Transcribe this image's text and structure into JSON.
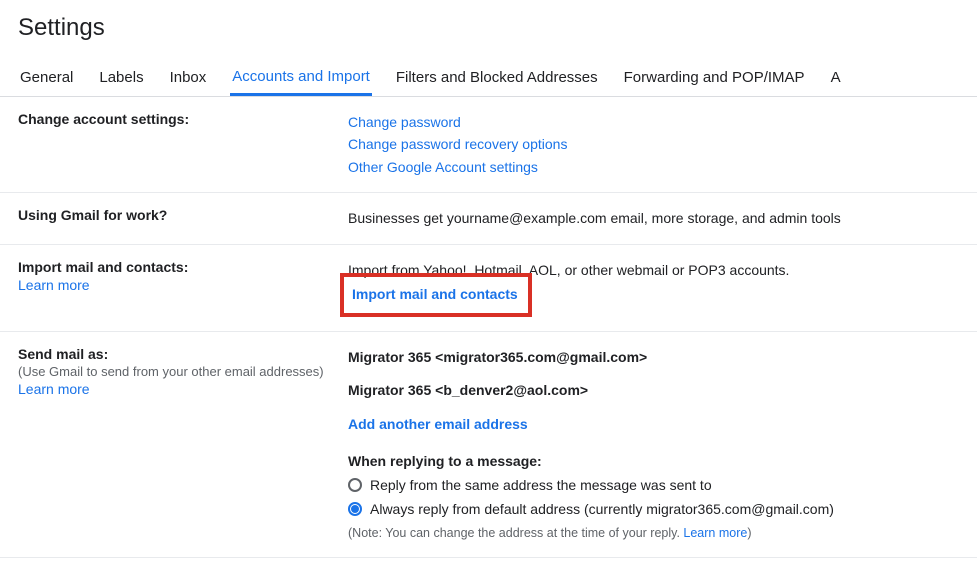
{
  "page": {
    "title": "Settings"
  },
  "tabs": {
    "general": "General",
    "labels": "Labels",
    "inbox": "Inbox",
    "accounts": "Accounts and Import",
    "filters": "Filters and Blocked Addresses",
    "forwarding": "Forwarding and POP/IMAP",
    "addons_cut": "A"
  },
  "changeAccount": {
    "label": "Change account settings:",
    "links": {
      "changePassword": "Change password",
      "recovery": "Change password recovery options",
      "other": "Other Google Account settings"
    }
  },
  "work": {
    "label": "Using Gmail for work?",
    "text": "Businesses get yourname@example.com email, more storage, and admin tools"
  },
  "importSection": {
    "label": "Import mail and contacts:",
    "learn": "Learn more",
    "desc": "Import from Yahoo!, Hotmail, AOL, or other webmail or POP3 accounts.",
    "action": "Import mail and contacts"
  },
  "sendAs": {
    "label": "Send mail as:",
    "sub": "(Use Gmail to send from your other email addresses)",
    "learn": "Learn more",
    "addr1": "Migrator 365 <migrator365.com@gmail.com>",
    "addr2": "Migrator 365 <b_denver2@aol.com>",
    "addAnother": "Add another email address",
    "replyHeading": "When replying to a message:",
    "opt1": "Reply from the same address the message was sent to",
    "opt2": "Always reply from default address (currently migrator365.com@gmail.com)",
    "notePrefix": "(Note: You can change the address at the time of your reply. ",
    "noteLink": "Learn more",
    "noteSuffix": ")"
  }
}
